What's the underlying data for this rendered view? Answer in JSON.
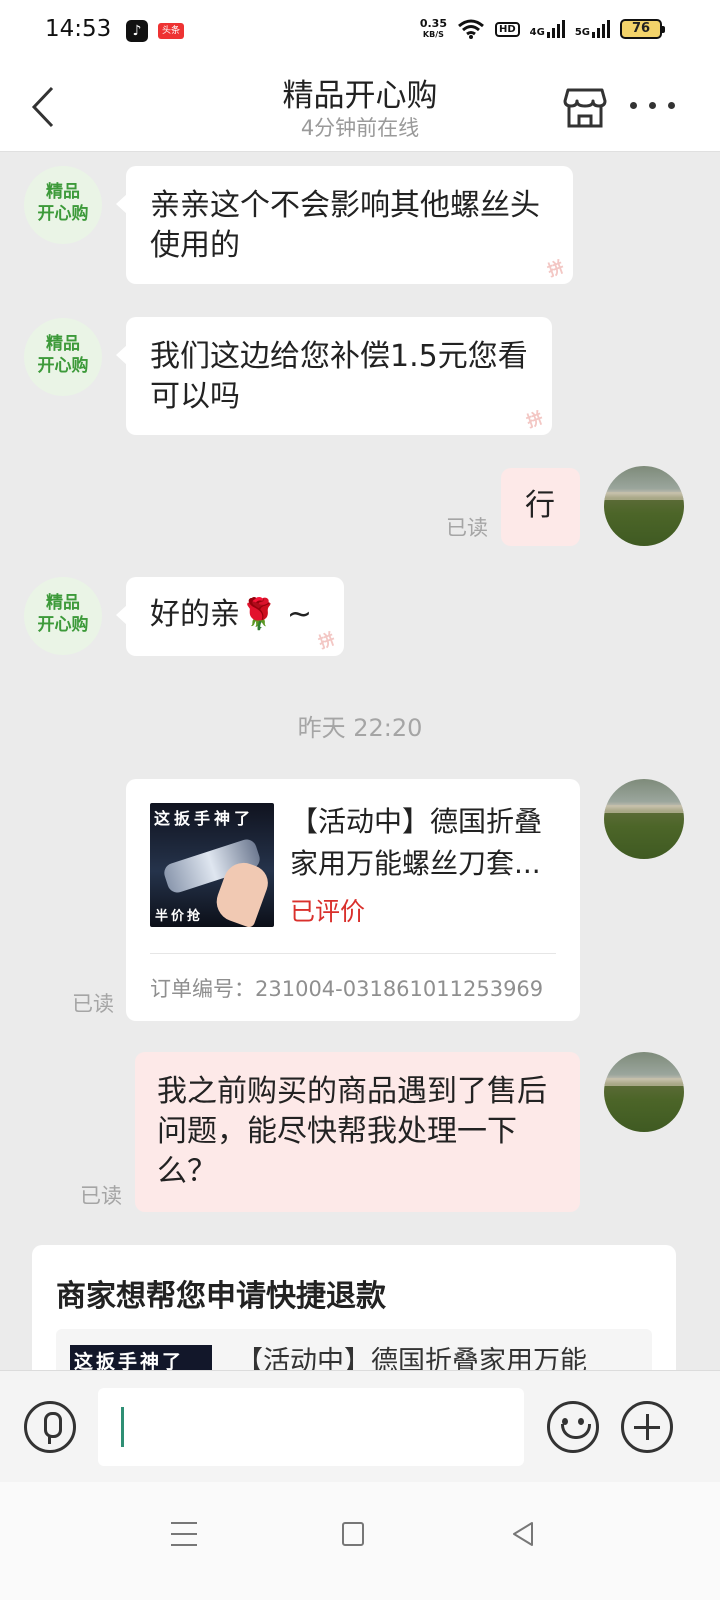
{
  "status_bar": {
    "time": "14:53",
    "app_icon_1": "tiktok-icon",
    "app_icon_2_label": "头条",
    "net_speed_value": "0.35",
    "net_speed_unit": "KB/S",
    "hd_badge": "HD",
    "network_1": "4G",
    "network_2": "5G",
    "battery": "76"
  },
  "header": {
    "title": "精品开心购",
    "subtitle": "4分钟前在线",
    "back_icon": "chevron-left-icon",
    "store_icon": "store-icon",
    "more_icon": "more-dots-icon"
  },
  "shop_avatar_text": [
    "精品",
    "开心购"
  ],
  "messages": {
    "m1": "亲亲这个不会影响其他螺丝头使用的",
    "m2": "我们这边给您补偿1.5元您看可以吗",
    "m3": "行",
    "m4": "好的亲🌹 ~",
    "m7": "我之前购买的商品遇到了售后问题，能尽快帮我处理一下么？"
  },
  "read_label": "已读",
  "time_separator": "昨天 22:20",
  "order_card": {
    "thumb_top": "这扳手神了",
    "thumb_bottom": "半价抢",
    "title": "【活动中】德国折叠家用万能螺丝刀套...",
    "status": "已评价",
    "order_number": "订单编号：231004-031861011253969",
    "status_color": "#d9302c"
  },
  "refund_card": {
    "title": "商家想帮您申请快捷退款",
    "thumb_text": "这扳手神了",
    "product_text": "【活动中】德国折叠家用万能"
  },
  "input_bar": {
    "voice_icon": "microphone-icon",
    "emoji_icon": "emoji-icon",
    "plus_icon": "plus-icon",
    "input_value": "",
    "input_placeholder": ""
  },
  "nav_bar": {
    "menu_icon": "menu-icon",
    "home_icon": "home-square-icon",
    "back_icon": "back-triangle-icon"
  },
  "colors": {
    "accent_green": "#3d9a3a",
    "outgoing_bubble": "#fde9e8",
    "background": "#ebebeb"
  }
}
